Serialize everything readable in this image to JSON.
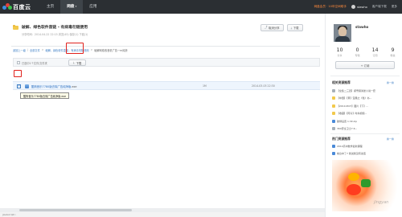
{
  "topbar": {
    "logo_text": "百度云",
    "nav": [
      {
        "label": "主页"
      },
      {
        "label": "网盘"
      },
      {
        "label": "应用"
      }
    ],
    "promo": "网盘会员 · 10年空间助手",
    "username": "stawho",
    "links": [
      "客户端下载",
      "更多"
    ],
    "bg_color": "#2b2f33"
  },
  "share": {
    "title": "破解、绿色软件直链 - 有病毒勿随便用",
    "meta": "分享时间：2014-04-22 22:15  浏览(45)  保存(1)  下载(1)",
    "buttons": [
      {
        "label": "取消分享",
        "icon": "unshare-icon"
      },
      {
        "label": "下载",
        "icon": "download-icon"
      }
    ]
  },
  "breadcrumb": [
    "返回上一级",
    "全部文件",
    "破解、绿色软件直链 - 有病毒勿随便用",
    "破解网络收音机广告一m纯析"
  ],
  "toolbar": {
    "select_all": "已选中1个文件/文件夹",
    "download_label": "下载"
  },
  "file": {
    "name": "酷狗音乐7780版去除广告纯净版",
    "ext": ".exe",
    "size": "1M",
    "date": "2014-03-03 22:30"
  },
  "tooltip": "酷狗音乐7780版去除广告纯净版.exe",
  "statusbar": "javascript:;",
  "sidebar": {
    "username": "stawho",
    "stats": [
      {
        "num": "10",
        "label": "分享"
      },
      {
        "num": "0",
        "label": "专辑"
      },
      {
        "num": "14",
        "label": "订阅"
      },
      {
        "num": "9",
        "label": "粉丝"
      }
    ],
    "follow_label": "+ 订阅",
    "related_title": "相关资源推荐",
    "related_more": "换一换",
    "related": [
      {
        "label": "【全集二三四】郑雪丽讲述小说一套",
        "icon": "gray"
      },
      {
        "label": "【中国】【黄】宝典之《色》书...",
        "icon": "yellow"
      },
      {
        "label": "【20110307】图片【下】...",
        "icon": "yellow"
      },
      {
        "label": "【收藏】【阿冷】时尚视频...",
        "icon": "yellow"
      },
      {
        "label": "破绿设置 1.hit.zip",
        "icon": "blue"
      },
      {
        "label": "360安全卫士7.6...",
        "icon": "gray"
      }
    ],
    "hot_title": "热门资源推荐",
    "hot_more": "换一换",
    "hot": [
      {
        "label": "2014高中数学最新课程",
        "icon": "blue"
      },
      {
        "label": "前台中了7 我说我没有说话",
        "icon": "blue"
      },
      {
        "label": "2014年高考分数线最新",
        "icon": "blue"
      }
    ]
  }
}
